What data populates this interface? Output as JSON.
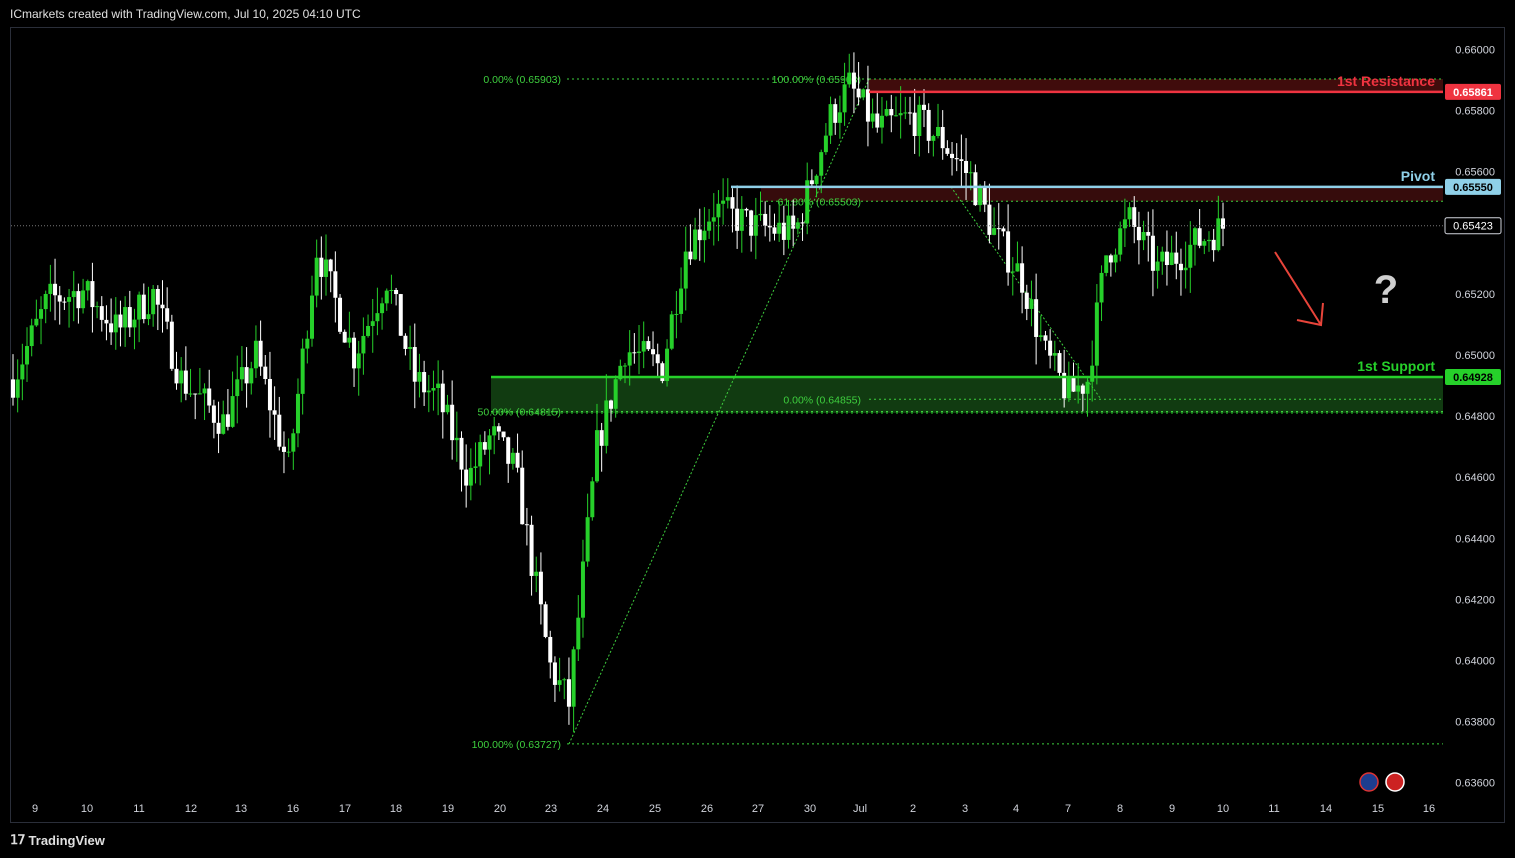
{
  "header": {
    "title": "ICmarkets created with TradingView.com, Jul 10, 2025 04:10 UTC"
  },
  "footer": {
    "brand": "TradingView"
  },
  "colors": {
    "bull": "#26d02a",
    "bear": "#ffffff",
    "resistance": "#ef3340",
    "pivot": "#8fd0e8",
    "support": "#26d02a",
    "fib": "#3ecf3e",
    "arrow": "#e8443a",
    "question": "#cfcfcf"
  },
  "icons": [
    "australia-flag-icon",
    "us-flag-icon",
    "tradingview-logo-icon"
  ],
  "chart_data": {
    "type": "candlestick",
    "x_ticks": [
      "9",
      "10",
      "11",
      "12",
      "13",
      "16",
      "17",
      "18",
      "19",
      "20",
      "23",
      "24",
      "25",
      "26",
      "27",
      "30",
      "Jul",
      "2",
      "3",
      "4",
      "7",
      "8",
      "9",
      "10",
      "11",
      "14",
      "15",
      "16"
    ],
    "ylim": [
      0.6355,
      0.6607
    ],
    "y_ticks": [
      "0.66000",
      "0.65800",
      "0.65600",
      "0.65200",
      "0.65000",
      "0.64800",
      "0.64600",
      "0.64400",
      "0.64200",
      "0.64000",
      "0.63800",
      "0.63600"
    ],
    "levels": {
      "resistance": {
        "label": "1st Resistance",
        "value": 0.65861,
        "value_label": "0.65861"
      },
      "pivot": {
        "label": "Pivot",
        "value": 0.6555,
        "value_label": "0.65550"
      },
      "support": {
        "label": "1st Support",
        "value": 0.64928,
        "value_label": "0.64928",
        "zone_low": 0.6481
      },
      "current": {
        "value": 0.65423,
        "value_label": "0.65423"
      }
    },
    "fib_labels": [
      {
        "text": "0.00% (0.65903)",
        "value": 0.65903
      },
      {
        "text": "100.00% (0.65903)",
        "value": 0.65903
      },
      {
        "text": "61.80% (0.65503)",
        "value": 0.65503
      },
      {
        "text": "50.00% (0.64815)",
        "value": 0.64815
      },
      {
        "text": "0.00% (0.64855)",
        "value": 0.64855
      },
      {
        "text": "100.00% (0.63727)",
        "value": 0.63727
      }
    ],
    "annotations": {
      "question": "?"
    },
    "anchors": [
      [
        0,
        0.6492
      ],
      [
        15,
        0.6518
      ],
      [
        30,
        0.6521
      ],
      [
        45,
        0.6508
      ],
      [
        60,
        0.652
      ],
      [
        72,
        0.6492
      ],
      [
        90,
        0.6478
      ],
      [
        104,
        0.65
      ],
      [
        118,
        0.6463
      ],
      [
        130,
        0.6535
      ],
      [
        146,
        0.65
      ],
      [
        160,
        0.6525
      ],
      [
        172,
        0.6492
      ],
      [
        182,
        0.6486
      ],
      [
        195,
        0.646
      ],
      [
        205,
        0.6474
      ],
      [
        215,
        0.6462
      ],
      [
        230,
        0.6398
      ],
      [
        238,
        0.6386
      ],
      [
        250,
        0.647
      ],
      [
        262,
        0.6502
      ],
      [
        278,
        0.6496
      ],
      [
        288,
        0.6535
      ],
      [
        300,
        0.6548
      ],
      [
        318,
        0.6542
      ],
      [
        335,
        0.654
      ],
      [
        350,
        0.6578
      ],
      [
        358,
        0.6588
      ],
      [
        370,
        0.6574
      ],
      [
        385,
        0.6578
      ],
      [
        398,
        0.657
      ],
      [
        410,
        0.6558
      ],
      [
        420,
        0.654
      ],
      [
        432,
        0.6525
      ],
      [
        442,
        0.65
      ],
      [
        452,
        0.6487
      ],
      [
        460,
        0.6492
      ],
      [
        468,
        0.6533
      ],
      [
        478,
        0.6544
      ],
      [
        490,
        0.6528
      ],
      [
        505,
        0.6536
      ],
      [
        518,
        0.6542
      ]
    ],
    "candle_count": 260
  }
}
